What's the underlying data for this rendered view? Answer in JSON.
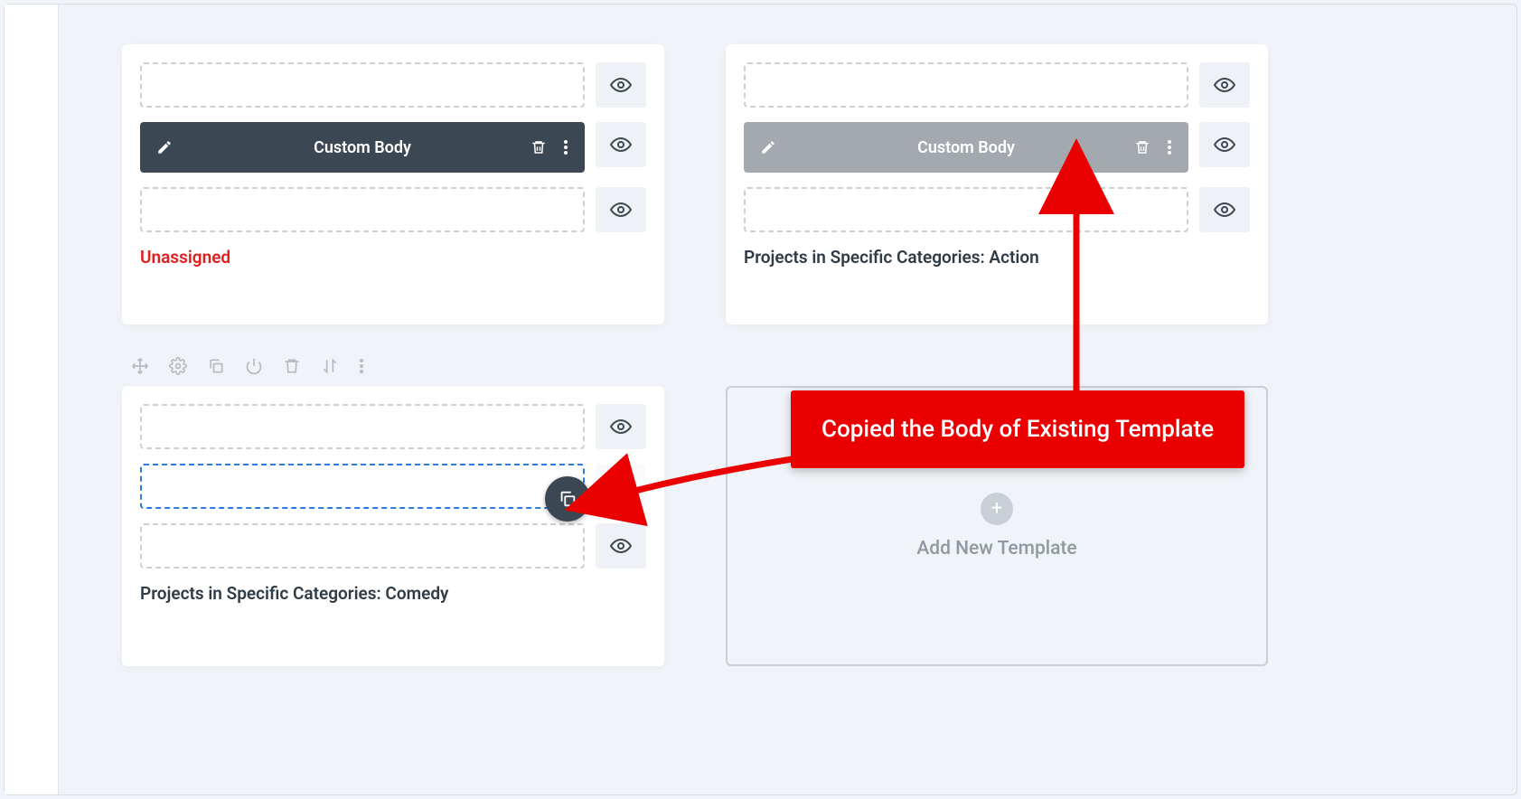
{
  "cards": {
    "topLeft": {
      "body_label": "Custom Body",
      "caption": "Unassigned"
    },
    "topRight": {
      "body_label": "Custom Body",
      "caption": "Projects in Specific Categories: Action"
    },
    "bottomLeft": {
      "caption": "Projects in Specific Categories: Comedy"
    }
  },
  "addPanel": {
    "label": "Add New Template"
  },
  "callout": {
    "text": "Copied the Body of Existing Template"
  }
}
